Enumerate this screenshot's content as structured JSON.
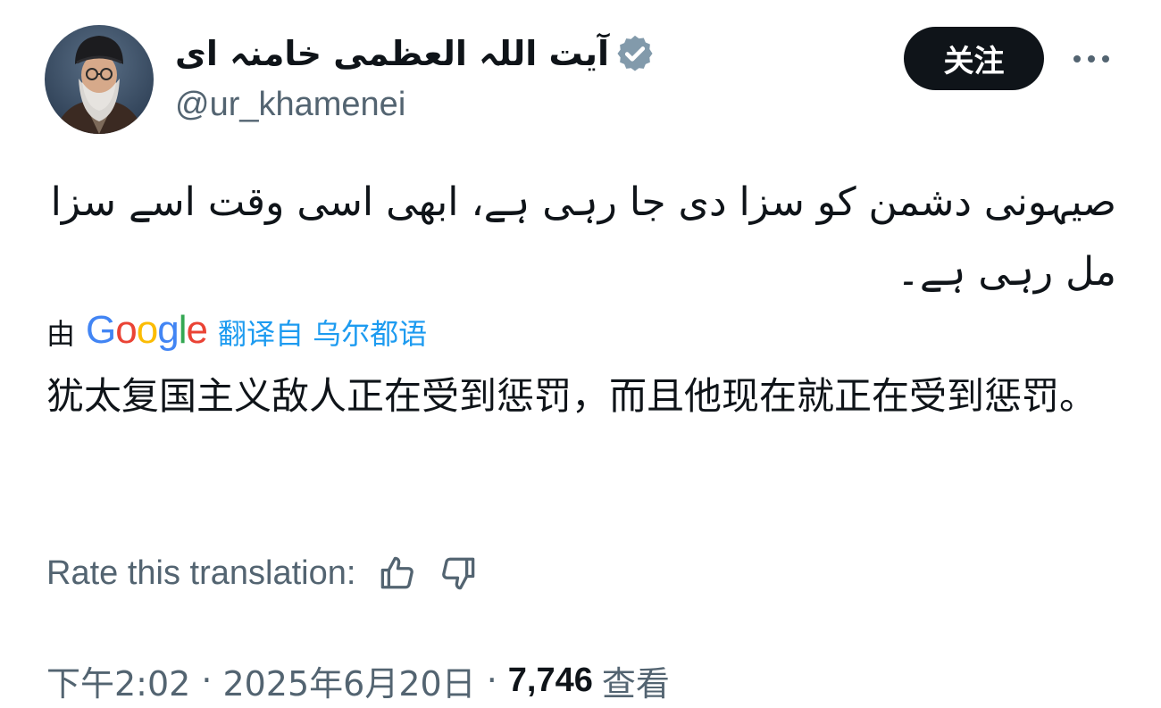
{
  "author": {
    "display_name": "آیت اللہ العظمی خامنہ ای",
    "handle": "@ur_khamenei",
    "verified_color": "#829aab"
  },
  "actions": {
    "follow_label": "关注"
  },
  "tweet": {
    "original_text": "صیہونی دشمن کو سزا دی جا رہی ہے، ابھی اسی وقت اسے سزا مل رہی ہے۔",
    "translation_by_prefix": "由",
    "translation_provider": "Google",
    "translation_link": "翻译自 乌尔都语",
    "translated_text": "犹太复国主义敌人正在受到惩罚，而且他现在就正在受到惩罚。"
  },
  "rate": {
    "label": "Rate this translation:",
    "up_icon": "thumbs-up-icon",
    "down_icon": "thumbs-down-icon"
  },
  "meta": {
    "time": "下午2:02",
    "separator": "·",
    "date": "2025年6月20日",
    "views_count": "7,746",
    "views_label": "查看"
  },
  "colors": {
    "text_primary": "#0f1419",
    "text_secondary": "#536471",
    "link_blue": "#1d9bf0",
    "follow_bg": "#0f1419"
  }
}
